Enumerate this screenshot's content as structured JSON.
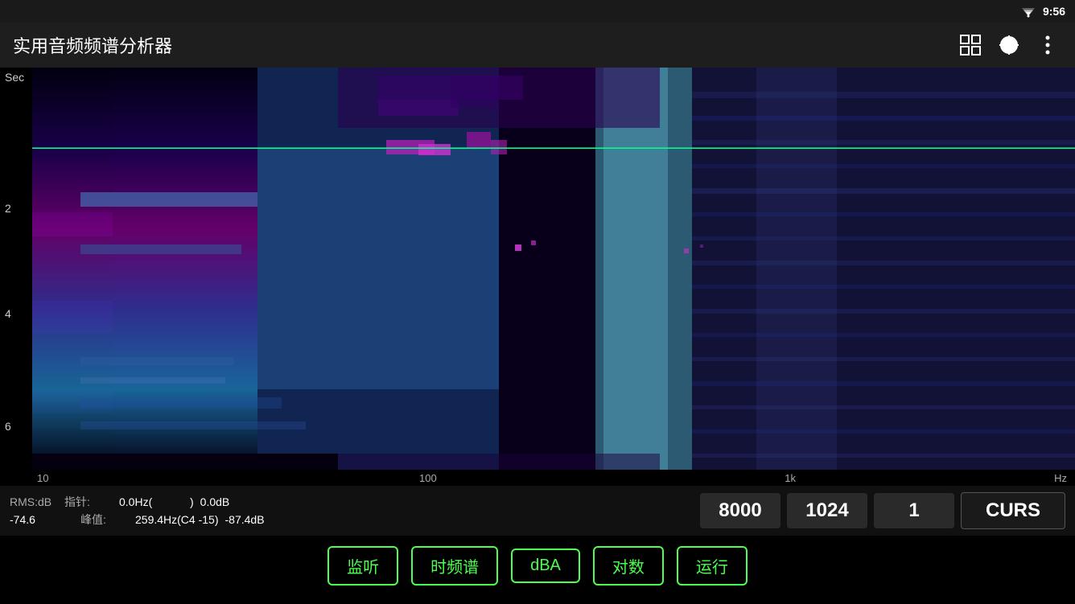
{
  "statusBar": {
    "time": "9:56"
  },
  "toolbar": {
    "title": "实用音频频谱分析器",
    "expandIcon": "expand-icon",
    "targetIcon": "target-icon",
    "menuIcon": "menu-icon"
  },
  "yAxis": {
    "label": "Sec",
    "ticks": [
      {
        "value": "2",
        "pos": 33
      },
      {
        "value": "4",
        "pos": 58
      },
      {
        "value": "6",
        "pos": 85
      }
    ]
  },
  "xAxis": {
    "label": "Hz",
    "ticks": [
      {
        "value": "10",
        "pos": 3
      },
      {
        "value": "100",
        "pos": 41
      },
      {
        "value": "1k",
        "pos": 73
      },
      {
        "value": "Hz",
        "pos": 96
      }
    ]
  },
  "infoBar": {
    "row1": {
      "label1": "RMS:dB",
      "label2": "指针:",
      "value1": "0.0Hz(",
      "value1b": ")",
      "value2": "0.0dB"
    },
    "row2": {
      "value_rms": "-74.6",
      "label2": "峰值:",
      "value_peak_hz": "259.4Hz(C4 -15)",
      "value_peak_db": "-87.4dB"
    }
  },
  "controls": {
    "btn1": "8000",
    "btn2": "1024",
    "btn3": "1",
    "btn4": "CURS"
  },
  "bottomButtons": [
    {
      "label": "监听",
      "name": "listen-button"
    },
    {
      "label": "时频谱",
      "name": "spectrogram-button"
    },
    {
      "label": "dBA",
      "name": "dba-button"
    },
    {
      "label": "对数",
      "name": "log-button"
    },
    {
      "label": "运行",
      "name": "run-button"
    }
  ]
}
